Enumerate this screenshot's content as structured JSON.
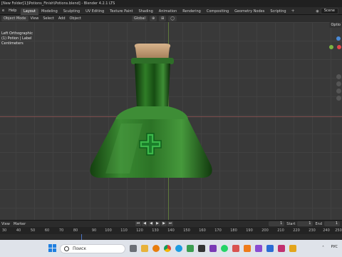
{
  "window": {
    "title": "[New Folder[1]\\Potions_Finish\\Potions.blend] - Blender 4.2.1 LTS"
  },
  "menu": {
    "items": [
      "e",
      "Help"
    ]
  },
  "workspace_tabs": [
    {
      "label": "Layout",
      "active": true
    },
    {
      "label": "Modeling"
    },
    {
      "label": "Sculpting"
    },
    {
      "label": "UV Editing"
    },
    {
      "label": "Texture Paint"
    },
    {
      "label": "Shading"
    },
    {
      "label": "Animation"
    },
    {
      "label": "Rendering"
    },
    {
      "label": "Compositing"
    },
    {
      "label": "Geometry Nodes"
    },
    {
      "label": "Scripting"
    }
  ],
  "scene": {
    "label": "Scene",
    "icon": "scene-icon"
  },
  "viewport_header": {
    "mode": "Object Mode",
    "menus": [
      "View",
      "Select",
      "Add",
      "Object"
    ],
    "orientation": "Global"
  },
  "viewport_overlay": {
    "view_name": "Left Orthographic",
    "object_name": "(1) Potion | Label",
    "units": "Centimeters"
  },
  "options_button": "Optio",
  "timeline": {
    "menus": [
      "View",
      "Marker"
    ],
    "current_frame": "1",
    "start_label": "Start",
    "start_value": "1",
    "end_label": "End",
    "end_value": "1",
    "ruler_ticks": [
      "30",
      "40",
      "50",
      "60",
      "70",
      "80",
      "90",
      "100",
      "110",
      "120",
      "130",
      "140",
      "150",
      "160",
      "170",
      "180",
      "190",
      "200",
      "210",
      "220",
      "230",
      "240",
      "250"
    ]
  },
  "taskbar": {
    "search_placeholder": "Поиск",
    "language": "РУС"
  },
  "colors": {
    "accent": "#4b73c3",
    "bottle_green": "#2f7a2a",
    "cork": "#c9a27a",
    "label_cross": "#3cb84a"
  }
}
